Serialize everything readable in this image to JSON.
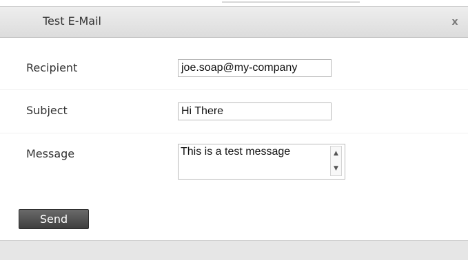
{
  "dialog": {
    "title": "Test E-Mail",
    "close_glyph": "x"
  },
  "form": {
    "recipient_label": "Recipient",
    "recipient_value": "joe.soap@my-company",
    "subject_label": "Subject",
    "subject_value": "Hi There",
    "message_label": "Message",
    "message_value": "This is a test message"
  },
  "actions": {
    "send_label": "Send"
  },
  "icons": {
    "close": "close-icon",
    "scroll_up": "scroll-up-arrow-icon",
    "scroll_down": "scroll-down-arrow-icon"
  },
  "colors": {
    "send_button": "#4a4a4a",
    "titlebar": "#e3e3e3"
  }
}
